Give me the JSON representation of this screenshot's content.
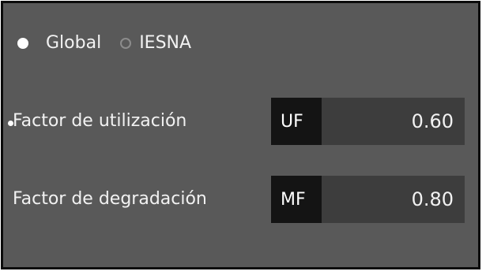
{
  "mode": {
    "options": [
      {
        "label": "Global",
        "checked": true
      },
      {
        "label": "IESNA",
        "checked": false
      }
    ]
  },
  "factors": [
    {
      "label": "Factor de utilización",
      "code": "UF",
      "value": "0.60"
    },
    {
      "label": "Factor de degradación",
      "code": "MF",
      "value": "0.80"
    }
  ]
}
